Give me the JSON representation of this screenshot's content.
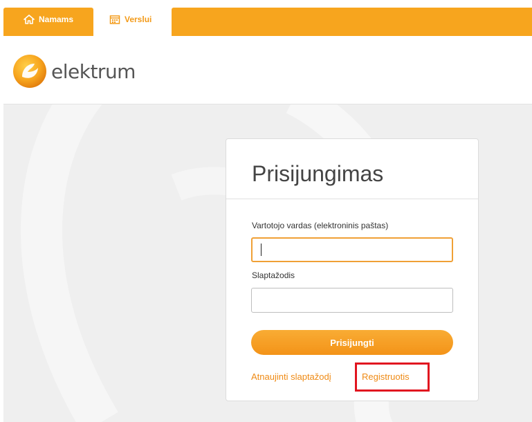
{
  "tabs": [
    {
      "label": "Namams",
      "icon": "home-icon",
      "active": false
    },
    {
      "label": "Verslui",
      "icon": "calendar-icon",
      "active": true
    }
  ],
  "logo": {
    "text": "elektrum",
    "icon": "elektrum-logo-mark"
  },
  "login": {
    "title": "Prisijungimas",
    "username_label": "Vartotojo vardas (elektroninis paštas)",
    "username_value": "",
    "password_label": "Slaptažodis",
    "password_value": "",
    "submit_label": "Prisijungti",
    "reset_link": "Atnaujinti slaptažodį",
    "register_link": "Registruotis"
  },
  "colors": {
    "accent": "#f7a51e",
    "link": "#ef8a14",
    "highlight": "#e1141f"
  }
}
